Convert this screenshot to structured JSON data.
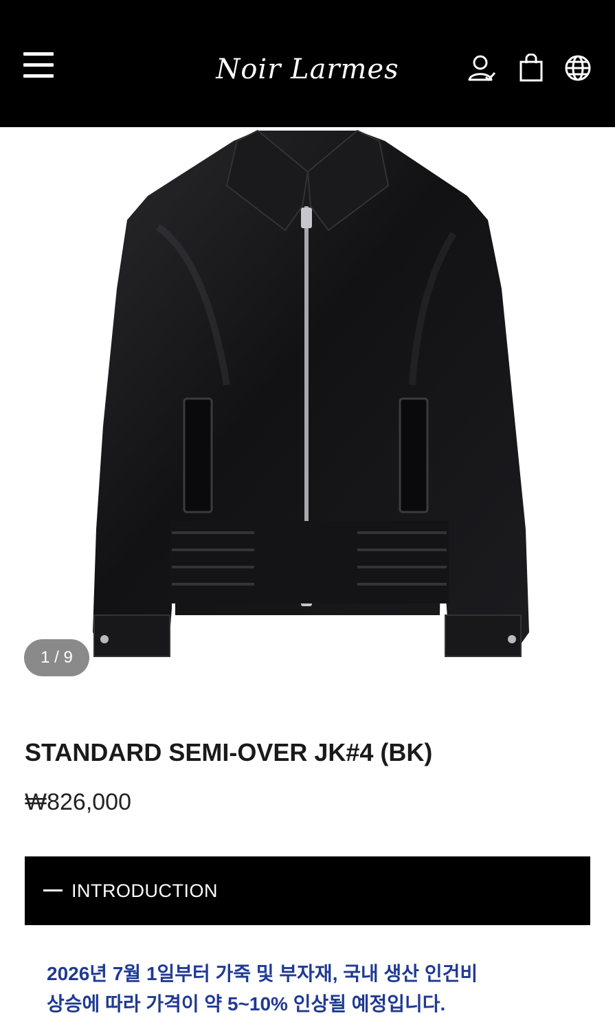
{
  "header": {
    "brand": "Noir Larmes",
    "colors": {
      "background": "#000000",
      "foreground": "#ffffff"
    },
    "icons": [
      "menu-icon",
      "account-icon",
      "shopping-bag-icon",
      "globe-icon"
    ]
  },
  "gallery": {
    "counter": "1 / 9",
    "image_subject": "black leather jacket"
  },
  "product": {
    "title": "STANDARD SEMI-OVER JK#4 (BK)",
    "price": "₩826,000"
  },
  "accordion": {
    "label": "INTRODUCTION",
    "expanded_icon": "minus-icon"
  },
  "notice": {
    "line1": "2026년 7월 1일부터 가죽 및 부자재, 국내 생산 인건비",
    "line2": "상승에 따라 가격이 약 5~10% 인상될 예정입니다.",
    "color": "#1f3a93"
  }
}
